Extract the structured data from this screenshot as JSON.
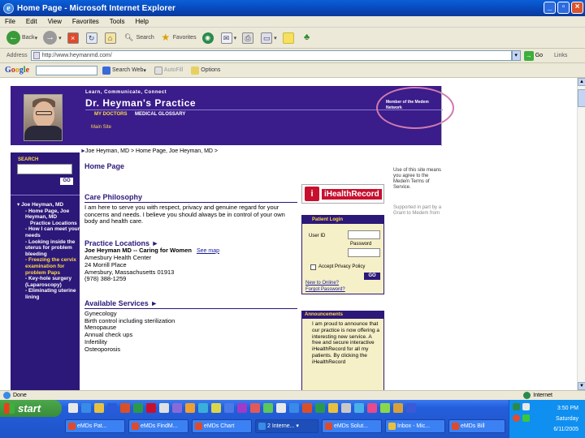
{
  "window": {
    "title": "Home Page - Microsoft Internet Explorer"
  },
  "menu": [
    "File",
    "Edit",
    "View",
    "Favorites",
    "Tools",
    "Help"
  ],
  "toolbar": {
    "back": "Back",
    "search": "Search",
    "favorites": "Favorites"
  },
  "address": {
    "label": "Address",
    "url": "http://www.heymanmd.com/",
    "go": "Go",
    "links": "Links"
  },
  "google": {
    "search_web": "Search Web",
    "autofill": "AutoFill",
    "options": "Options"
  },
  "site": {
    "tagline": "Learn, Communicate, Connect",
    "practice_name": "Dr. Heyman's Practice",
    "nav": [
      "MY DOCTORS",
      "MEDICAL GLOSSARY"
    ],
    "subnav": "Main Site",
    "member": "Member of the Medem Network",
    "breadcrumb": "Joe Heyman, MD > Home Page, Joe Heyman, MD >",
    "search_label": "SEARCH",
    "go": "GO",
    "side_nav": [
      {
        "text": "▾ Joe Heyman, MD",
        "level": 1,
        "yellow": false
      },
      {
        "text": "- Home Page, Joe Heyman, MD",
        "level": 2,
        "yellow": false
      },
      {
        "text": "Practice Locations",
        "level": 2,
        "yellow": false
      },
      {
        "text": "- How I can meet your needs",
        "level": 2,
        "yellow": false
      },
      {
        "text": "- Looking inside the uterus for problem bleeding",
        "level": 2,
        "yellow": false
      },
      {
        "text": "- Freezing the cervix examination for problem Paps",
        "level": 2,
        "yellow": true
      },
      {
        "text": "- Key-hole surgery (Laparoscopy)",
        "level": 2,
        "yellow": false
      },
      {
        "text": "- Eliminating uterine lining",
        "level": 2,
        "yellow": false
      }
    ],
    "home_heading": "Home Page",
    "care_heading": "Care Philosophy",
    "care_text": "I am here to serve you with respect, privacy and genuine regard for your concerns and needs. I believe you should always be in control of your own body and health care.",
    "locations_heading": "Practice Locations",
    "location_name": "Joe Heyman MD -- Caring for Women",
    "see_map": "See map",
    "location_lines": [
      "Amesbury Health Center",
      "24 Morrill Place",
      "Amesbury, Massachusetts 01913",
      "(978) 388-1259"
    ],
    "services_heading": "Available Services",
    "services": [
      "Gynecology",
      "Birth control including sterilization",
      "Menopause",
      "Annual check ups",
      "Infertility",
      "Osteoporosis"
    ],
    "ihealth": "iHealthRecord",
    "terms": "Use of this site means you agree to the Medem Terms of Service.",
    "supported": "Supported in part by a Grant to Medem from",
    "login": {
      "heading": "Patient Login",
      "userid": "User ID",
      "password": "Password",
      "accept": "Accept Privacy Policy",
      "go": "GO",
      "new": "New to Online?",
      "forgot": "Forgot Password?"
    },
    "announcements": {
      "heading": "Announcements",
      "text": "I am proud to announce that our practice is now offering a interesting new service. A free and secure interactive iHealthRecord for all my patients. By clicking the iHealthRecord"
    }
  },
  "status": {
    "left": "Done",
    "zone": "Internet"
  },
  "taskbar": {
    "start": "start",
    "tasks": [
      "eMDs Pat...",
      "eMDs FindM...",
      "eMDs Chart",
      "2 Interne...",
      "eMDs Solut...",
      "Inbox - Mic...",
      "eMDs Bill"
    ],
    "time": "3:50 PM",
    "day": "Saturday",
    "date": "6/11/2005"
  }
}
